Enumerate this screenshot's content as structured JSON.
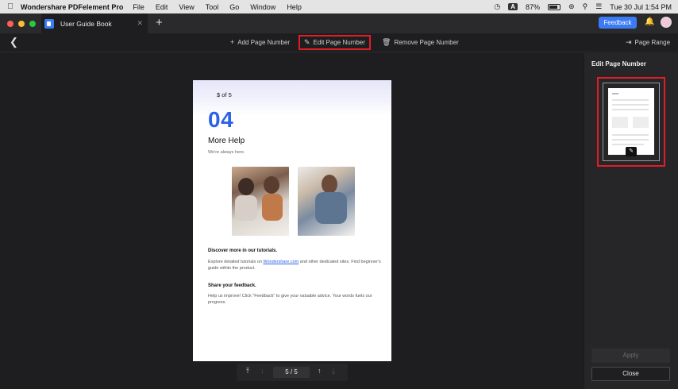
{
  "menubar": {
    "app_name": "Wondershare PDFelement Pro",
    "items": [
      "File",
      "Edit",
      "View",
      "Tool",
      "Go",
      "Window",
      "Help"
    ],
    "keyboard_input": "A",
    "battery": "87%",
    "datetime": "Tue 30 Jul  1:54 PM"
  },
  "titlebar": {
    "tab_title": "User Guide Book",
    "feedback_label": "Feedback"
  },
  "toolbar": {
    "add_label": "Add Page Number",
    "edit_label": "Edit Page Number",
    "remove_label": "Remove Page Number",
    "range_label": "Page Range"
  },
  "document": {
    "page_number_text": "$ of 5",
    "big_number": "04",
    "heading": "More Help",
    "subheading": "We're always here.",
    "discover_title": "Discover more in our tutorials.",
    "explore_before": "Explore detailed tutorials on ",
    "explore_link": "Wondershare.com",
    "explore_after": " and other dedicated sites. Find beginner's guide within the product.",
    "share_title": "Share your feedback.",
    "help_text": "Help us improve! Click \"Feedback\" to give your valuable advice. Your words fuels our progress."
  },
  "pager": {
    "current": "5",
    "separator": "/",
    "total": "5"
  },
  "panel": {
    "title": "Edit Page Number",
    "apply_label": "Apply",
    "close_label": "Close"
  },
  "colors": {
    "accent": "#3b7bf6",
    "highlight": "#e01e26",
    "number_blue": "#2d63e6"
  }
}
